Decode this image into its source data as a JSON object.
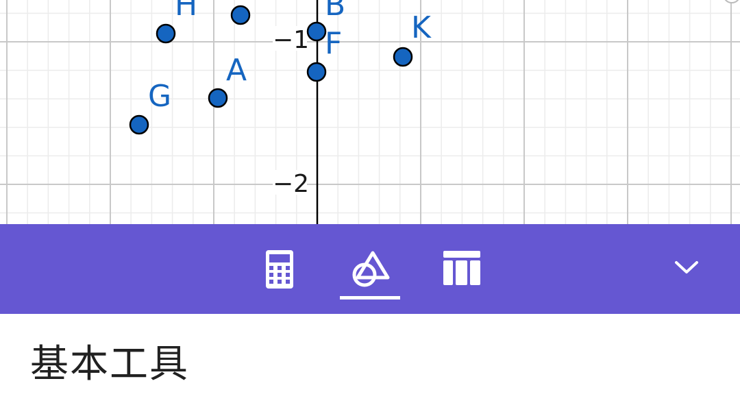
{
  "graphics": {
    "x_axis_labels": [],
    "y_axis_labels": [
      "−1",
      "−2"
    ],
    "points": [
      {
        "name": "H",
        "label": "H"
      },
      {
        "name": "B",
        "label": "B"
      },
      {
        "name": "F",
        "label": "F"
      },
      {
        "name": "K",
        "label": "K"
      },
      {
        "name": "A",
        "label": "A"
      },
      {
        "name": "G",
        "label": "G"
      },
      {
        "name": "unlabeled-1",
        "label": ""
      },
      {
        "name": "unlabeled-2",
        "label": ""
      }
    ],
    "colors": {
      "point_fill": "#1565c0",
      "point_stroke": "#000000",
      "grid_major": "#c8c8c8",
      "grid_minor": "#ececec",
      "axis": "#000000"
    }
  },
  "toolbar": {
    "tabs": [
      {
        "id": "algebra",
        "icon": "calculator-icon",
        "selected": false
      },
      {
        "id": "tools",
        "icon": "shapes-icon",
        "selected": true
      },
      {
        "id": "table",
        "icon": "table-icon",
        "selected": false
      }
    ],
    "collapse_icon": "chevron-down-icon",
    "background": "#6557d2"
  },
  "panel": {
    "heading": "基本工具"
  }
}
